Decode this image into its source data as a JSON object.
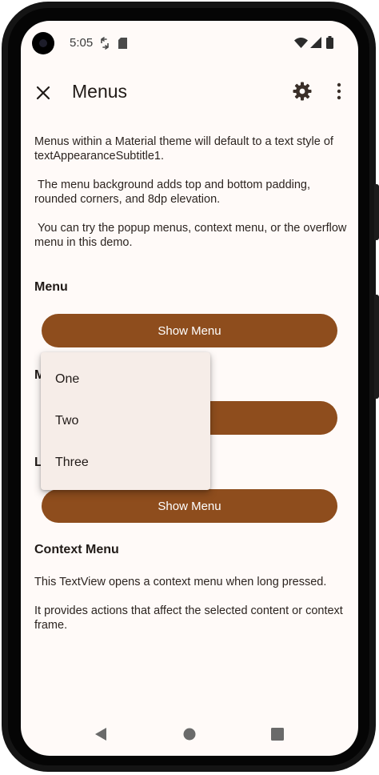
{
  "status_bar": {
    "time": "5:05"
  },
  "toolbar": {
    "title": "Menus"
  },
  "intro": {
    "paragraphs": [
      "Menus within a Material theme will default to a text style of textAppearanceSubtitle1.",
      " The menu background adds top and bottom padding, rounded corners, and 8dp elevation.",
      " You can try the popup menus, context menu, or the overflow menu in this demo."
    ]
  },
  "sections": [
    {
      "heading": "Menu",
      "button_label": "Show Menu"
    },
    {
      "heading": "M",
      "button_label": "nu"
    },
    {
      "heading": "L",
      "button_label": "Show Menu"
    }
  ],
  "popup_menu": {
    "items": [
      "One",
      "Two",
      "Three"
    ]
  },
  "context_section": {
    "heading": "Context Menu",
    "text1": "This TextView opens a context menu when long pressed.",
    "text2": "It provides actions that affect the selected content or context frame."
  },
  "colors": {
    "accent": "#8e4d1d",
    "background": "#fffaf8",
    "menu_surface": "#f6ede8"
  }
}
